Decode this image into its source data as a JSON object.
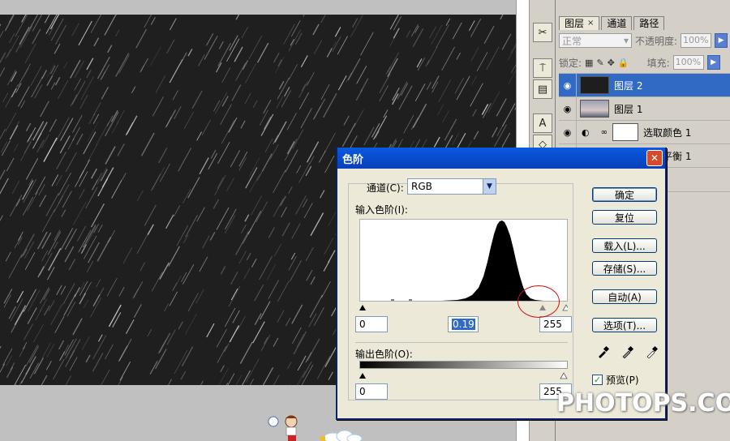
{
  "layers_panel": {
    "tabs": [
      {
        "label": "图层",
        "active": true,
        "closable": true
      },
      {
        "label": "通道",
        "active": false
      },
      {
        "label": "路径",
        "active": false
      }
    ],
    "blend_mode": "正常",
    "opacity_label": "不透明度:",
    "opacity_value": "100%",
    "lock_label": "锁定:",
    "fill_label": "填充:",
    "fill_value": "100%",
    "layers": [
      {
        "name": "图层 2",
        "selected": true,
        "thumb": "dark-rain"
      },
      {
        "name": "图层 1",
        "selected": false,
        "thumb": "photo"
      },
      {
        "name": "选取颜色 1",
        "selected": false,
        "thumb": "adjustment"
      },
      {
        "name": "平衡 1",
        "selected": false,
        "thumb": "hidden"
      }
    ]
  },
  "levels_dialog": {
    "title": "色阶",
    "channel_label": "通道(C):",
    "channel_value": "RGB",
    "input_levels_label": "输入色阶(I):",
    "input_black": "0",
    "input_gamma": "0.19",
    "input_white": "255",
    "output_levels_label": "输出色阶(O):",
    "output_black": "0",
    "output_white": "255",
    "buttons": {
      "ok": "确定",
      "reset": "复位",
      "load": "载入(L)...",
      "save": "存储(S)...",
      "auto": "自动(A)",
      "options": "选项(T)..."
    },
    "preview_label": "预览(P)",
    "preview_checked": true
  },
  "watermark": "PHOTOPS.COM",
  "colors": {
    "selection_blue": "#316ac5",
    "title_blue": "#0a5ae0",
    "annotation_red": "#d01010"
  }
}
